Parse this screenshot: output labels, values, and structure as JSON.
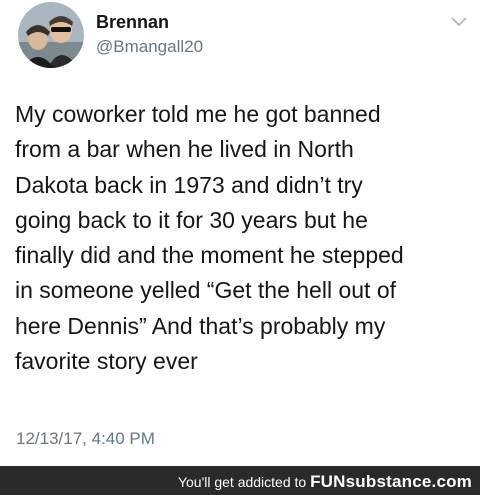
{
  "tweet": {
    "author_name": "Brennan",
    "author_handle": "@Bmangall20",
    "text_lines": [
      "My coworker told me he got banned",
      "from a bar when he lived in North",
      "Dakota back in 1973 and didn’t try",
      "going back to it for 30 years but he",
      "finally did and the moment he stepped",
      "in someone yelled “Get the hell out of",
      "here Dennis” And that’s probably my",
      "favorite story ever"
    ],
    "timestamp": "12/13/17, 4:40 PM",
    "menu_icon": "chevron-down-icon",
    "avatar_icon": "avatar"
  },
  "footer": {
    "tagline": "You'll get addicted to",
    "brand": "FUNsubstance.com"
  },
  "colors": {
    "name": "#14171a",
    "secondary": "#657786",
    "footer_bg": "#2a2a2a"
  }
}
